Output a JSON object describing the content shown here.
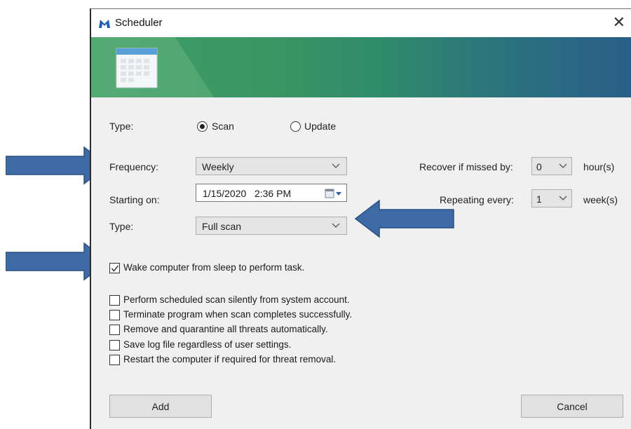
{
  "window": {
    "title": "Scheduler",
    "close_glyph": "✕"
  },
  "type_row": {
    "label": "Type:",
    "options": [
      "Scan",
      "Update"
    ],
    "selected": "Scan"
  },
  "frequency": {
    "label": "Frequency:",
    "value": "Weekly"
  },
  "starting_on": {
    "label": "Starting on:",
    "date": "1/15/2020",
    "time": "2:36 PM"
  },
  "scan_type": {
    "label": "Type:",
    "value": "Full scan"
  },
  "recover": {
    "label": "Recover if missed by:",
    "value": "0",
    "unit": "hour(s)"
  },
  "repeating": {
    "label": "Repeating every:",
    "value": "1",
    "unit": "week(s)"
  },
  "wake": {
    "label": "Wake computer from sleep to perform task.",
    "checked": true
  },
  "options": [
    {
      "label": "Perform scheduled scan silently from system account.",
      "checked": false
    },
    {
      "label": "Terminate program when scan completes successfully.",
      "checked": false
    },
    {
      "label": "Remove and quarantine all threats automatically.",
      "checked": false
    },
    {
      "label": "Save log file regardless of user settings.",
      "checked": false
    },
    {
      "label": "Restart the computer if required for threat removal.",
      "checked": false
    }
  ],
  "buttons": {
    "add": "Add",
    "cancel": "Cancel"
  },
  "colors": {
    "banner_start": "#3f9f64",
    "banner_end": "#2a5f88",
    "annotation_arrow": "#3e6aa6"
  },
  "icons": {
    "app": "malwarebytes-logo-icon",
    "banner": "calendar-icon"
  }
}
